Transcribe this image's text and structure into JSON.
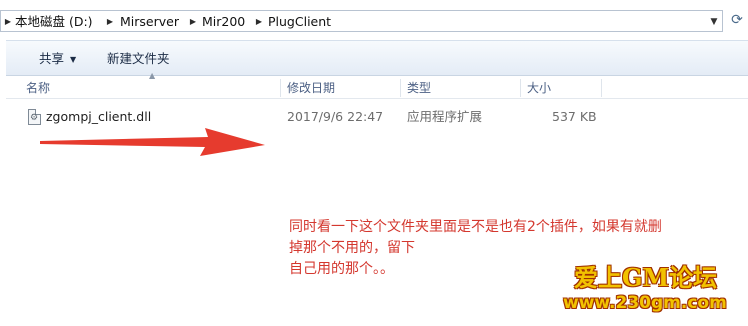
{
  "address_bar": {
    "crumbs": [
      "本地磁盘 (D:)",
      "Mirserver",
      "Mir200",
      "PlugClient"
    ]
  },
  "toolbar": {
    "share_label": "共享",
    "new_folder_label": "新建文件夹"
  },
  "columns": {
    "name": "名称",
    "modified": "修改日期",
    "type": "类型",
    "size": "大小"
  },
  "files": [
    {
      "name": "zgompj_client.dll",
      "modified": "2017/9/6 22:47",
      "type": "应用程序扩展",
      "size": "537 KB"
    }
  ],
  "annotation": {
    "line1": "同时看一下这个文件夹里面是不是也有2个插件，如果有就删掉那个不用的，留下",
    "line2": "自己用的那个。。"
  },
  "watermark": {
    "title": "爱上GM论坛",
    "url": "www.230gm.com"
  },
  "colors": {
    "annotation_red": "#d4382f",
    "arrow_red": "#e63b2e",
    "watermark_gold": "#f2c200"
  }
}
